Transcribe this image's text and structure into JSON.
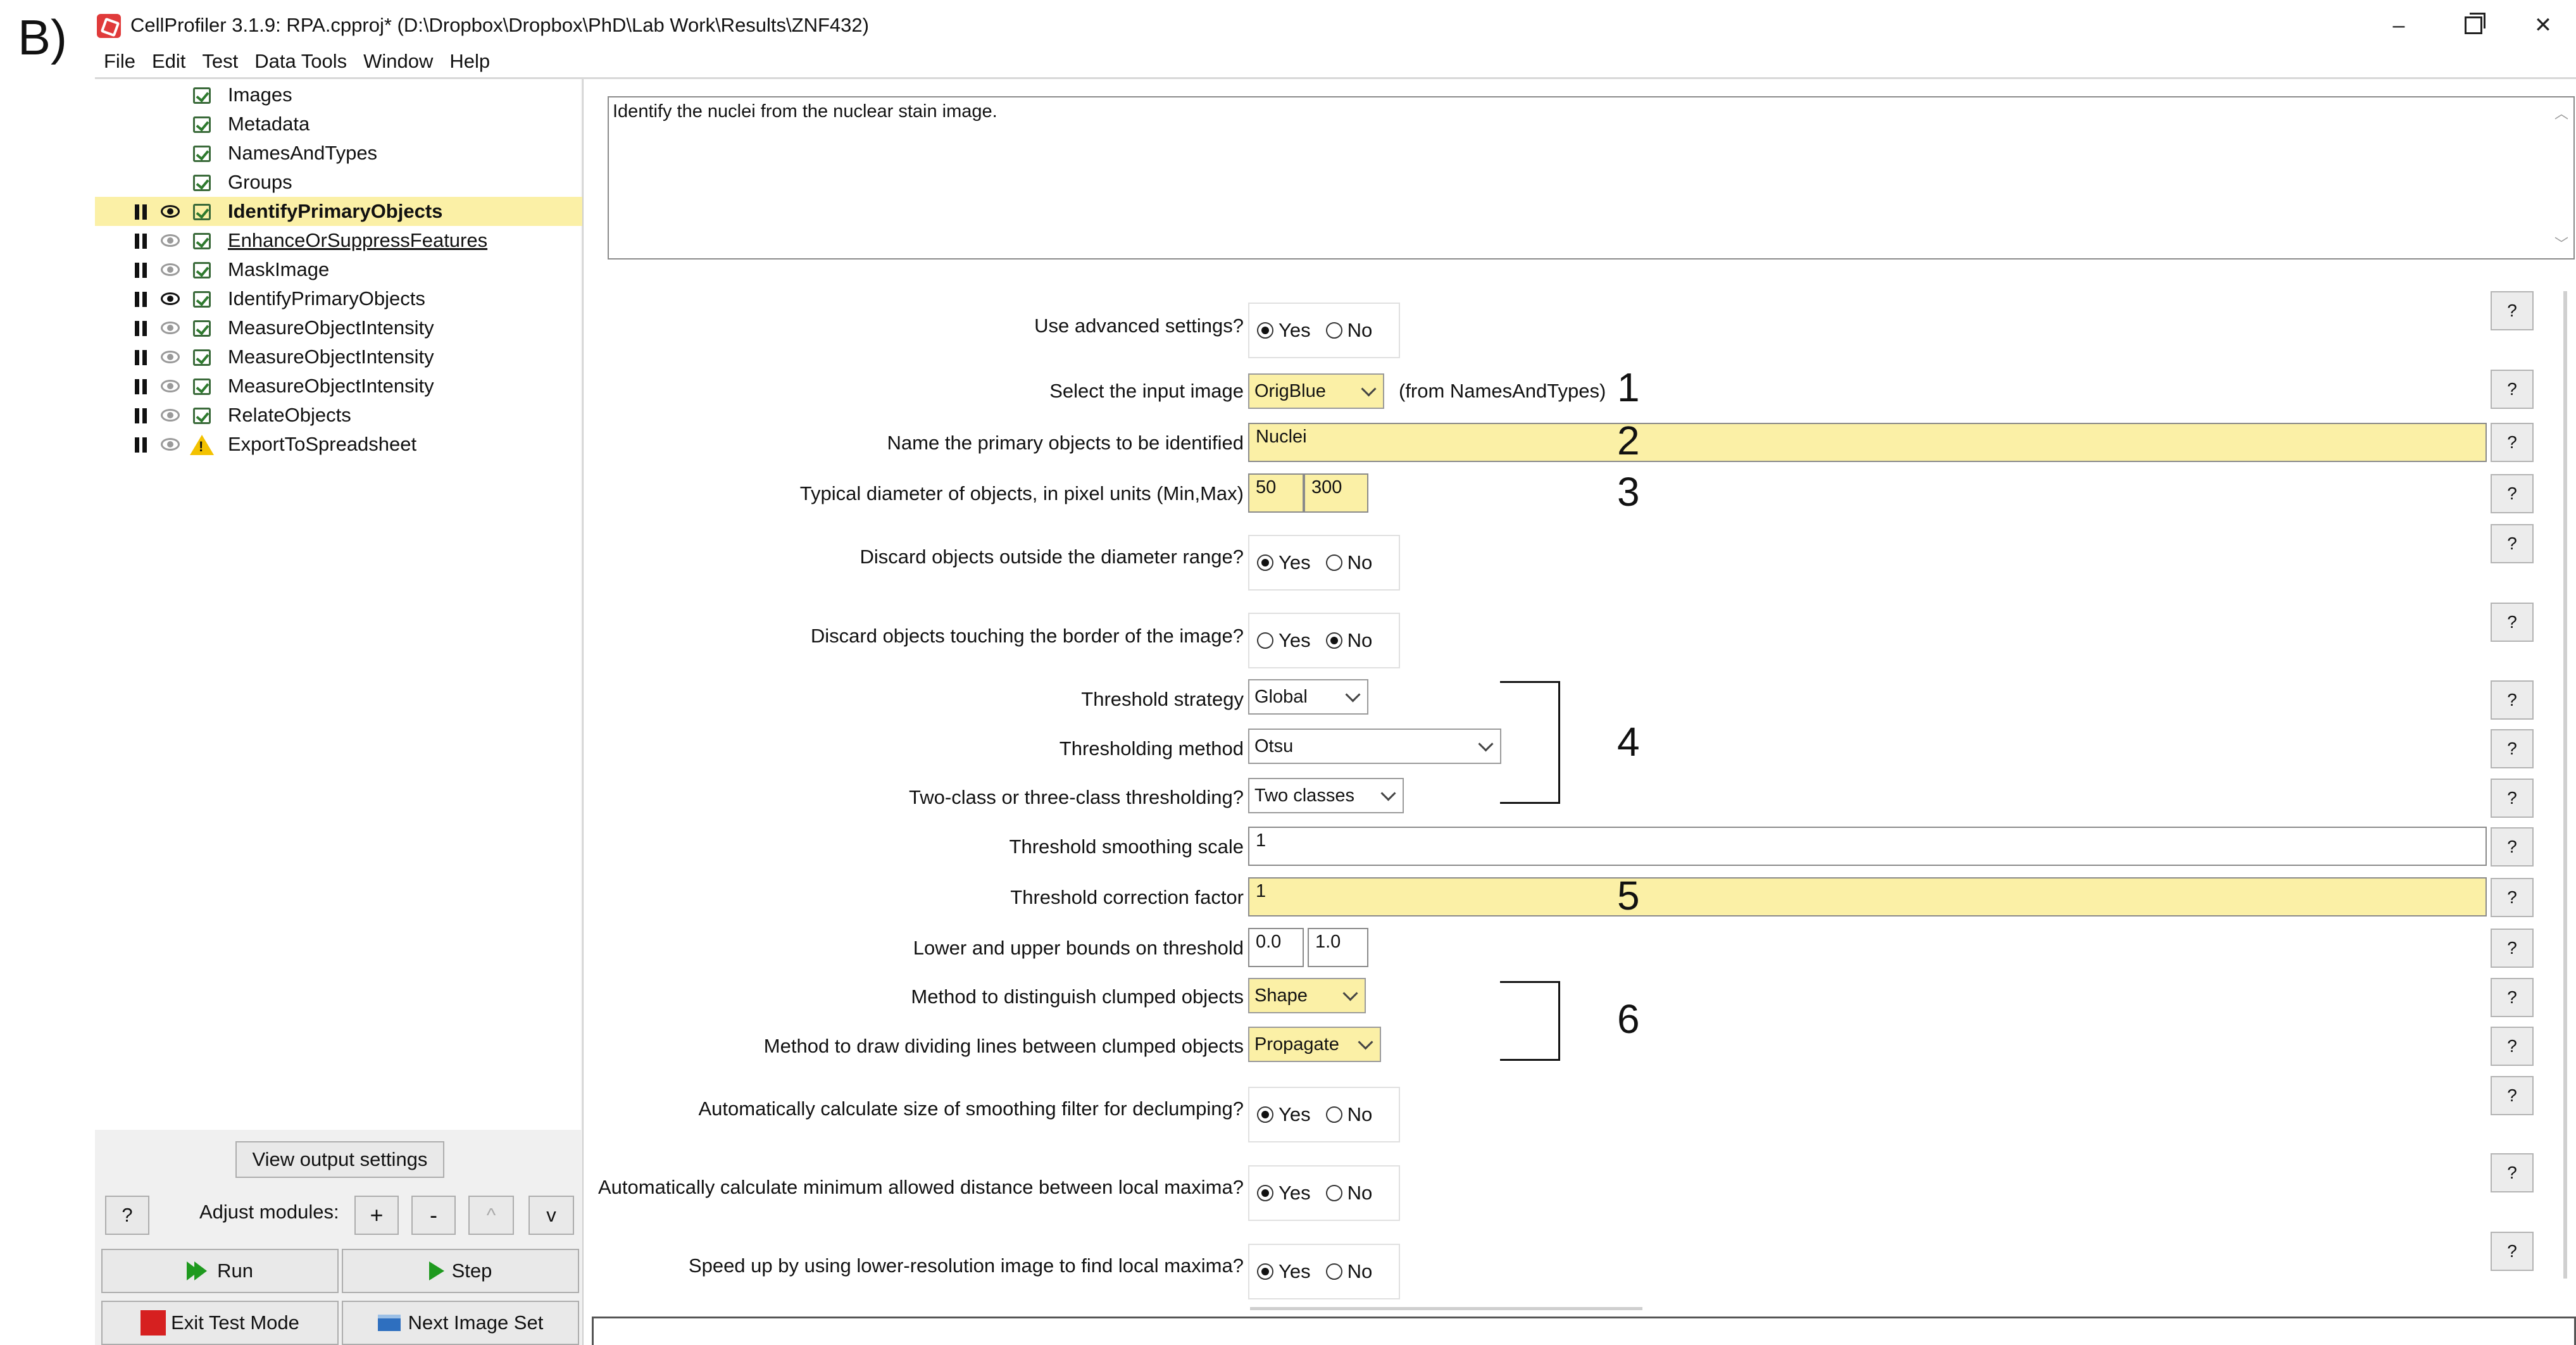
{
  "panel_label": "B)",
  "window": {
    "title": "CellProfiler 3.1.9: RPA.cpproj* (D:\\Dropbox\\Dropbox\\PhD\\Lab Work\\Results\\ZNF432)",
    "minimize": "–",
    "close": "✕"
  },
  "menu": [
    "File",
    "Edit",
    "Test",
    "Data Tools",
    "Window",
    "Help"
  ],
  "modules": [
    {
      "name": "Images",
      "status": "check"
    },
    {
      "name": "Metadata",
      "status": "check"
    },
    {
      "name": "NamesAndTypes",
      "status": "check"
    },
    {
      "name": "Groups",
      "status": "check"
    },
    {
      "name": "IdentifyPrimaryObjects",
      "status": "check",
      "eye": "open",
      "selected": true
    },
    {
      "name": "EnhanceOrSuppressFeatures",
      "status": "check",
      "eye": "hidden"
    },
    {
      "name": "MaskImage",
      "status": "check",
      "eye": "hidden"
    },
    {
      "name": "IdentifyPrimaryObjects",
      "status": "check",
      "eye": "open"
    },
    {
      "name": "MeasureObjectIntensity",
      "status": "check",
      "eye": "hidden"
    },
    {
      "name": "MeasureObjectIntensity",
      "status": "check",
      "eye": "hidden"
    },
    {
      "name": "MeasureObjectIntensity",
      "status": "check",
      "eye": "hidden"
    },
    {
      "name": "RelateObjects",
      "status": "check",
      "eye": "hidden"
    },
    {
      "name": "ExportToSpreadsheet",
      "status": "warning",
      "eye": "hidden"
    }
  ],
  "controls": {
    "view_output": "View output settings",
    "help": "?",
    "adjust_label": "Adjust modules:",
    "add": "+",
    "remove": "-",
    "up": "^",
    "down": "v",
    "run": "Run",
    "step": "Step",
    "exit_test": "Exit Test Mode",
    "next_image": "Next Image Set"
  },
  "notes": "Identify the nuclei from the nuclear stain image.",
  "settings": {
    "use_advanced": {
      "label": "Use advanced settings?",
      "value": "Yes"
    },
    "input_image": {
      "label": "Select the input image",
      "value": "OrigBlue",
      "suffix": "(from NamesAndTypes)"
    },
    "object_name": {
      "label": "Name the primary objects to be identified",
      "value": "Nuclei"
    },
    "diameter": {
      "label": "Typical diameter of objects, in pixel units (Min,Max)",
      "min": "50",
      "max": "300"
    },
    "discard_outside": {
      "label": "Discard objects outside the diameter range?",
      "value": "Yes"
    },
    "discard_border": {
      "label": "Discard objects touching the border of the image?",
      "value": "No"
    },
    "threshold_strategy": {
      "label": "Threshold strategy",
      "value": "Global"
    },
    "threshold_method": {
      "label": "Thresholding method",
      "value": "Otsu"
    },
    "threshold_classes": {
      "label": "Two-class or three-class thresholding?",
      "value": "Two classes"
    },
    "smoothing_scale": {
      "label": "Threshold smoothing scale",
      "value": "1"
    },
    "correction_factor": {
      "label": "Threshold correction factor",
      "value": "1"
    },
    "bounds": {
      "label": "Lower and upper bounds on threshold",
      "lower": "0.0",
      "upper": "1.0"
    },
    "clump_method": {
      "label": "Method to distinguish clumped objects",
      "value": "Shape"
    },
    "dividing_lines": {
      "label": "Method to draw dividing lines between clumped objects",
      "value": "Propagate"
    },
    "auto_smoothing": {
      "label": "Automatically calculate size of smoothing filter for declumping?",
      "value": "Yes"
    },
    "auto_min_distance": {
      "label": "Automatically calculate minimum allowed distance between local maxima?",
      "value": "Yes"
    },
    "low_res": {
      "label": "Speed up by using lower-resolution image to find local maxima?",
      "value": "Yes"
    }
  },
  "radio_labels": {
    "yes": "Yes",
    "no": "No"
  },
  "annotations": [
    "1",
    "2",
    "3",
    "4",
    "5",
    "6"
  ],
  "colors": {
    "highlight": "#fbf0a6",
    "panel": "#f0f0f0"
  }
}
